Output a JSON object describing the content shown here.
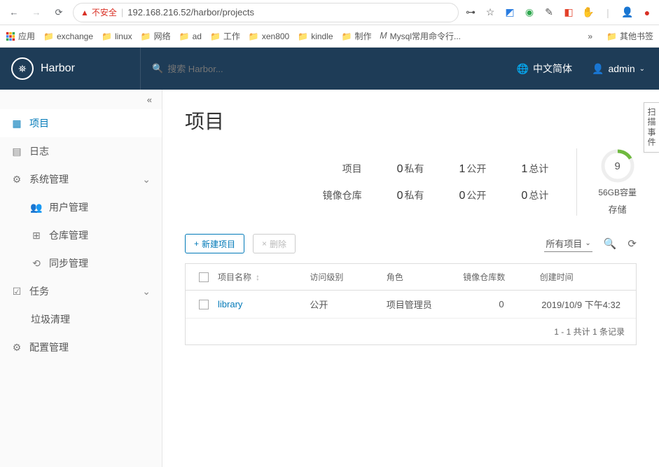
{
  "browser": {
    "insecure": "不安全",
    "url": "192.168.216.52/harbor/projects"
  },
  "bookmarks": {
    "apps": "应用",
    "items": [
      "exchange",
      "linux",
      "网络",
      "ad",
      "工作",
      "xen800",
      "kindle",
      "制作"
    ],
    "mysql": "Mysql常用命令行...",
    "other": "其他书签"
  },
  "header": {
    "brand": "Harbor",
    "search_placeholder": "搜索 Harbor...",
    "lang": "中文简体",
    "user": "admin"
  },
  "sidebar": {
    "projects": "项目",
    "logs": "日志",
    "sysadmin": "系统管理",
    "users": "用户管理",
    "repos": "仓库管理",
    "replication": "同步管理",
    "tasks": "任务",
    "gc": "垃圾清理",
    "config": "配置管理"
  },
  "page": {
    "title": "项目",
    "side_tab": "扫描事件"
  },
  "stats": {
    "row1_label": "项目",
    "row2_label": "镜像仓库",
    "private": "私有",
    "public": "公开",
    "total": "总计",
    "proj_priv": "0",
    "proj_pub": "1",
    "proj_tot": "1",
    "repo_priv": "0",
    "repo_pub": "0",
    "repo_tot": "0",
    "storage_val": "9",
    "storage_cap": "56GB容量",
    "storage_label": "存储"
  },
  "toolbar": {
    "new": "新建项目",
    "delete": "删除",
    "filter": "所有项目"
  },
  "table": {
    "cols": [
      "项目名称",
      "访问级别",
      "角色",
      "镜像仓库数",
      "创建时间"
    ],
    "row": {
      "name": "library",
      "access": "公开",
      "role": "项目管理员",
      "repos": "0",
      "created": "2019/10/9 下午4:32"
    },
    "footer": "1 - 1 共计 1 条记录"
  }
}
